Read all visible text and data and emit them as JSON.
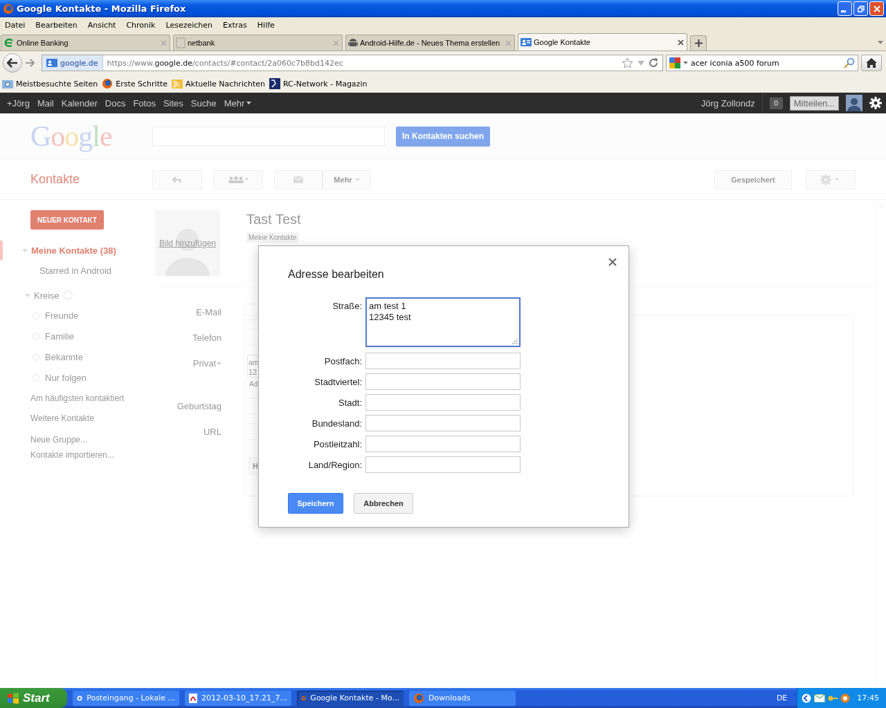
{
  "window": {
    "title": "Google Kontakte - Mozilla Firefox"
  },
  "menu": [
    "Datei",
    "Bearbeiten",
    "Ansicht",
    "Chronik",
    "Lesezeichen",
    "Extras",
    "Hilfe"
  ],
  "tabs": [
    {
      "label": "Online Banking",
      "selected": false
    },
    {
      "label": "netbank",
      "selected": false
    },
    {
      "label": "Android-Hilfe.de - Neues Thema erstellen",
      "selected": false
    },
    {
      "label": "Google Kontakte",
      "selected": true
    }
  ],
  "address_bar": {
    "site": "google.de",
    "url_prefix": "https://www.",
    "url_domain": "google.de",
    "url_path": "/contacts/#contact/2a060c7b8bd142ec"
  },
  "search": {
    "value": "acer iconia a500 forum"
  },
  "bookmarks": [
    "Meistbesuchte Seiten",
    "Erste Schritte",
    "Aktuelle Nachrichten",
    "RC-Network - Magazin"
  ],
  "google_bar": {
    "links": [
      "+Jörg",
      "Mail",
      "Kalender",
      "Docs",
      "Fotos",
      "Sites",
      "Suche",
      "Mehr"
    ],
    "user": "Jörg Zollondz",
    "notifications": "0",
    "share": "Mitteilen..."
  },
  "header": {
    "logo": "Google",
    "search_button": "In Kontakten suchen"
  },
  "toolbar": {
    "app_title": "Kontakte",
    "more": "Mehr",
    "saved": "Gespeichert"
  },
  "sidebar": {
    "new_contact": "NEUER KONTAKT",
    "my_contacts": {
      "label": "Meine Kontakte (38)",
      "selected": true,
      "expanded": true,
      "children": [
        {
          "label": "Starred in Android"
        }
      ]
    },
    "circles": {
      "label": "Kreise",
      "expanded": true,
      "children": [
        {
          "label": "Freunde"
        },
        {
          "label": "Familie"
        },
        {
          "label": "Bekannte"
        },
        {
          "label": "Nur folgen"
        }
      ]
    },
    "links": [
      "Am häufigsten kontaktiert",
      "Weitere Kontakte"
    ],
    "actions": [
      "Neue Gruppe...",
      "Kontakte importieren..."
    ]
  },
  "contact": {
    "name": "Tast Test",
    "add_photo": "Bild hinzufügen",
    "group_tag": "Meine Kontakte",
    "fields": [
      {
        "label": "E-Mail",
        "kind": "input"
      },
      {
        "label": "Telefon",
        "kind": "input"
      },
      {
        "label": "Privat",
        "kind": "address",
        "lines": [
          "am",
          "12"
        ],
        "link": "Ad"
      },
      {
        "label": "Geburtstag",
        "kind": "input"
      },
      {
        "label": "URL",
        "kind": "input"
      }
    ],
    "button": "H"
  },
  "dialog": {
    "title": "Adresse bearbeiten",
    "fields": [
      {
        "label": "Straße:",
        "kind": "textarea",
        "value": "am test 1\n12345 test",
        "focused": true
      },
      {
        "label": "Postfach:",
        "kind": "input",
        "focused": false
      },
      {
        "label": "Stadtviertel:",
        "kind": "input",
        "focused": false
      },
      {
        "label": "Stadt:",
        "kind": "input",
        "focused": false
      },
      {
        "label": "Bundesland:",
        "kind": "input",
        "focused": false
      },
      {
        "label": "Postleitzahl:",
        "kind": "input",
        "focused": false
      },
      {
        "label": "Land/Region:",
        "kind": "input",
        "focused": false
      }
    ],
    "save": "Speichern",
    "cancel": "Abbrechen"
  },
  "taskbar": {
    "start": "Start",
    "tasks": [
      {
        "label": "Posteingang - Lokale ...",
        "selected": false
      },
      {
        "label": "2012-03-10_17.21_7...",
        "selected": false
      },
      {
        "label": "Google Kontakte - Mo...",
        "selected": true
      },
      {
        "label": "Downloads",
        "selected": false
      }
    ],
    "language": "DE",
    "clock": "17:45"
  }
}
